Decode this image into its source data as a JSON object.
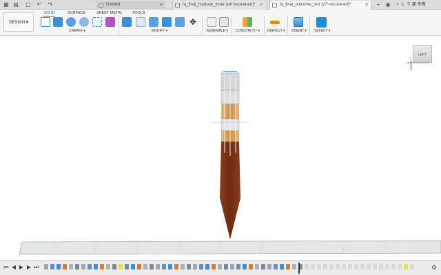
{
  "titlebar": {
    "tabs": [
      {
        "label": "Untitled"
      },
      {
        "label": "fa_final_modular_inner (v4~recovered)*"
      },
      {
        "label": "fa_final_outcome_test (v7~recovered)*"
      }
    ],
    "notification_count": "1",
    "user_name": "邵 冬梅"
  },
  "toolbar": {
    "design_label": "DESIGN ▾",
    "workspace_tabs": [
      "SOLID",
      "SURFACE",
      "SHEET METAL",
      "TOOLS"
    ],
    "active_tab": "SOLID",
    "groups": [
      "CREATE ▾",
      "MODIFY ▾",
      "ASSEMBLE ▾",
      "CONSTRUCT ▾",
      "INSPECT ▾",
      "INSERT ▾",
      "SELECT ▾"
    ]
  },
  "viewcube": {
    "face_label": "LEFT",
    "axis_y": "Y",
    "axis_z": "Z"
  },
  "colors": {
    "accent": "#0b7fd1",
    "wood_dark": "#7a3514",
    "wood_light": "#d9a765",
    "ground": "#dfe5df"
  },
  "icons": [
    "document-icon",
    "undo-icon",
    "redo-icon",
    "close-icon",
    "add-tab-icon",
    "profile-icon",
    "help-icon",
    "play-icon",
    "settings-icon"
  ]
}
